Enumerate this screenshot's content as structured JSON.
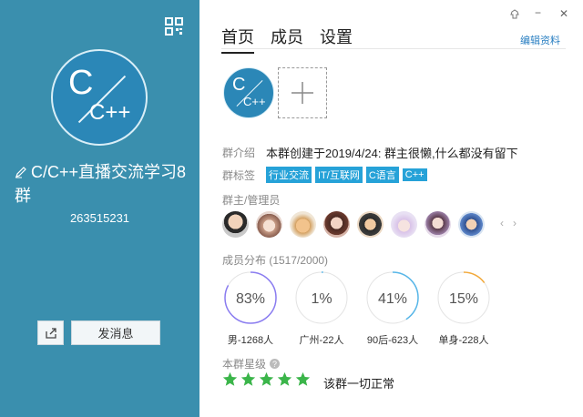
{
  "left_panel": {
    "logo": {
      "top": "C",
      "bottom": "C++"
    },
    "group_name": "C/C++直播交流学习8群",
    "group_id": "263515231",
    "send_message_label": "发消息"
  },
  "window_controls": {
    "min": "−",
    "close": "✕"
  },
  "tabs": [
    {
      "label": "首页",
      "active": true
    },
    {
      "label": "成员",
      "active": false
    },
    {
      "label": "设置",
      "active": false
    }
  ],
  "edit_profile_label": "编辑资料",
  "intro": {
    "label": "群介绍",
    "text": "本群创建于2019/4/24:  群主很懒,什么都没有留下"
  },
  "tags": {
    "label": "群标签",
    "items": [
      "行业交流",
      "IT/互联网",
      "C语言",
      "C++"
    ]
  },
  "admins": {
    "title": "群主/管理员",
    "nav_prev": "‹",
    "nav_next": "›"
  },
  "distribution": {
    "title": "成员分布 (1517/2000)",
    "items": [
      {
        "percent_label": "83%",
        "value": 0.83,
        "caption": "男-1268人",
        "color": "#8a7cf0"
      },
      {
        "percent_label": "1%",
        "value": 0.01,
        "caption": "广州-22人",
        "color": "#57b6e8"
      },
      {
        "percent_label": "41%",
        "value": 0.41,
        "caption": "90后-623人",
        "color": "#57b6e8"
      },
      {
        "percent_label": "15%",
        "value": 0.15,
        "caption": "单身-228人",
        "color": "#f2a93b"
      }
    ]
  },
  "level": {
    "title": "本群星级",
    "help": "?",
    "stars": 5,
    "status": "该群一切正常"
  },
  "colors": {
    "accent": "#26a2d8",
    "left_bg": "#3a8fae",
    "star": "#3bb54a"
  }
}
